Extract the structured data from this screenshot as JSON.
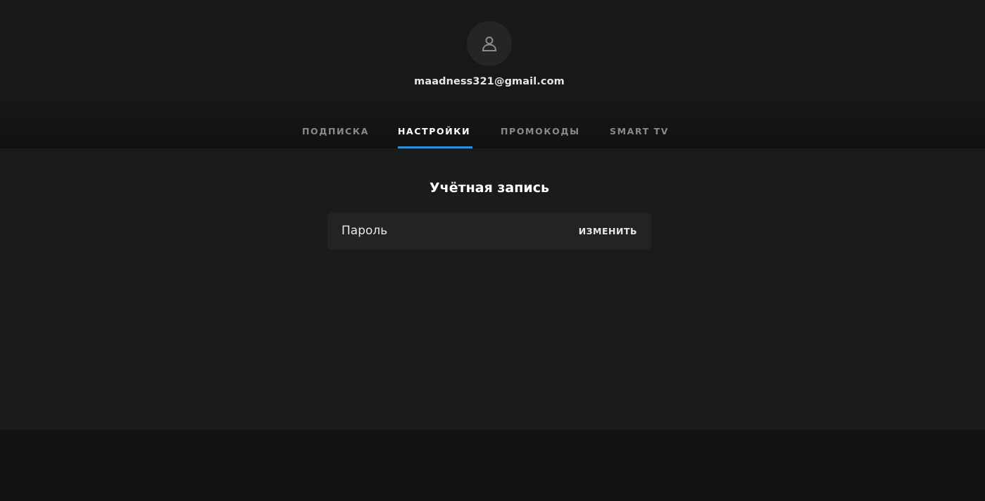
{
  "profile": {
    "avatar_icon": "user-icon",
    "email": "maadness321@gmail.com"
  },
  "tabs": [
    {
      "label": "ПОДПИСКА",
      "active": false
    },
    {
      "label": "НАСТРОЙКИ",
      "active": true
    },
    {
      "label": "ПРОМОКОДЫ",
      "active": false
    },
    {
      "label": "SMART TV",
      "active": false
    }
  ],
  "account": {
    "title": "Учётная запись",
    "password_row": {
      "label": "Пароль",
      "action": "ИЗМЕНИТЬ"
    }
  },
  "colors": {
    "accent": "#2f8fd8",
    "background": "#121212",
    "content_background": "#1b1b1b",
    "row_background": "#232323"
  }
}
